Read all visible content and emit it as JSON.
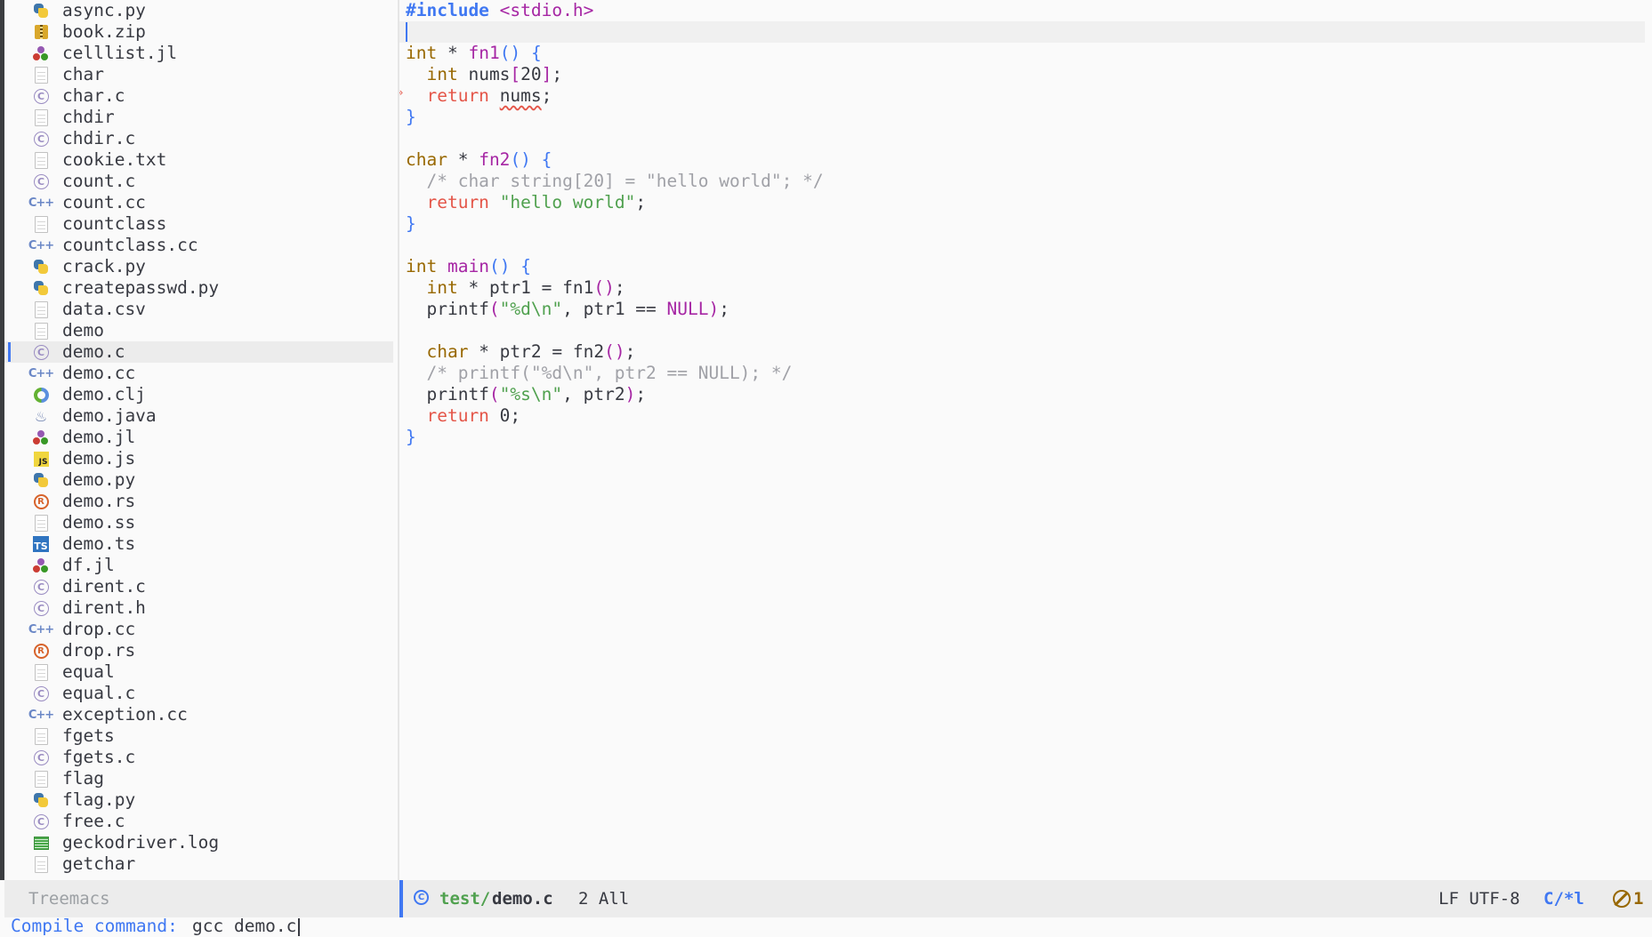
{
  "sidebar": {
    "label": "Treemacs",
    "files": [
      {
        "name": "async.py",
        "icon": "python-icon"
      },
      {
        "name": "book.zip",
        "icon": "zip-icon"
      },
      {
        "name": "celllist.jl",
        "icon": "julia-icon"
      },
      {
        "name": "char",
        "icon": "file-icon"
      },
      {
        "name": "char.c",
        "icon": "c-icon"
      },
      {
        "name": "chdir",
        "icon": "file-icon"
      },
      {
        "name": "chdir.c",
        "icon": "c-icon"
      },
      {
        "name": "cookie.txt",
        "icon": "file-icon"
      },
      {
        "name": "count.c",
        "icon": "c-icon"
      },
      {
        "name": "count.cc",
        "icon": "cpp-icon"
      },
      {
        "name": "countclass",
        "icon": "file-icon"
      },
      {
        "name": "countclass.cc",
        "icon": "cpp-icon"
      },
      {
        "name": "crack.py",
        "icon": "python-icon"
      },
      {
        "name": "createpasswd.py",
        "icon": "python-icon"
      },
      {
        "name": "data.csv",
        "icon": "file-icon"
      },
      {
        "name": "demo",
        "icon": "file-icon"
      },
      {
        "name": "demo.c",
        "icon": "c-icon",
        "selected": true
      },
      {
        "name": "demo.cc",
        "icon": "cpp-icon"
      },
      {
        "name": "demo.clj",
        "icon": "clojure-icon"
      },
      {
        "name": "demo.java",
        "icon": "java-icon"
      },
      {
        "name": "demo.jl",
        "icon": "julia-icon"
      },
      {
        "name": "demo.js",
        "icon": "javascript-icon"
      },
      {
        "name": "demo.py",
        "icon": "python-icon"
      },
      {
        "name": "demo.rs",
        "icon": "rust-icon"
      },
      {
        "name": "demo.ss",
        "icon": "file-icon"
      },
      {
        "name": "demo.ts",
        "icon": "typescript-icon"
      },
      {
        "name": "df.jl",
        "icon": "julia-icon"
      },
      {
        "name": "dirent.c",
        "icon": "c-icon"
      },
      {
        "name": "dirent.h",
        "icon": "c-icon"
      },
      {
        "name": "drop.cc",
        "icon": "cpp-icon"
      },
      {
        "name": "drop.rs",
        "icon": "rust-icon"
      },
      {
        "name": "equal",
        "icon": "file-icon"
      },
      {
        "name": "equal.c",
        "icon": "c-icon"
      },
      {
        "name": "exception.cc",
        "icon": "cpp-icon"
      },
      {
        "name": "fgets",
        "icon": "file-icon"
      },
      {
        "name": "fgets.c",
        "icon": "c-icon"
      },
      {
        "name": "flag",
        "icon": "file-icon"
      },
      {
        "name": "flag.py",
        "icon": "python-icon"
      },
      {
        "name": "free.c",
        "icon": "c-icon"
      },
      {
        "name": "geckodriver.log",
        "icon": "log-icon"
      },
      {
        "name": "getchar",
        "icon": "file-icon"
      }
    ]
  },
  "code": {
    "lines": [
      [
        {
          "t": "#include",
          "c": "kw-pre"
        },
        {
          "t": " "
        },
        {
          "t": "<stdio.h>",
          "c": "inc"
        }
      ],
      [],
      [
        {
          "t": "int",
          "c": "type"
        },
        {
          "t": " * "
        },
        {
          "t": "fn1",
          "c": "fn"
        },
        {
          "t": "()",
          "c": "paren"
        },
        {
          "t": " "
        },
        {
          "t": "{",
          "c": "paren"
        }
      ],
      [
        {
          "t": "  "
        },
        {
          "t": "int",
          "c": "type"
        },
        {
          "t": " nums"
        },
        {
          "t": "[",
          "c": "fn"
        },
        {
          "t": "20"
        },
        {
          "t": "]",
          "c": "fn"
        },
        {
          "t": ";"
        }
      ],
      [
        {
          "t": "  "
        },
        {
          "t": "return",
          "c": "ret"
        },
        {
          "t": " "
        },
        {
          "t": "nums",
          "c": "warn"
        },
        {
          "t": ";"
        }
      ],
      [
        {
          "t": "}",
          "c": "paren"
        }
      ],
      [],
      [
        {
          "t": "char",
          "c": "type"
        },
        {
          "t": " * "
        },
        {
          "t": "fn2",
          "c": "fn"
        },
        {
          "t": "()",
          "c": "paren"
        },
        {
          "t": " "
        },
        {
          "t": "{",
          "c": "paren"
        }
      ],
      [
        {
          "t": "  "
        },
        {
          "t": "/* char string[20] = \"hello world\"; */",
          "c": "cmt"
        }
      ],
      [
        {
          "t": "  "
        },
        {
          "t": "return",
          "c": "ret"
        },
        {
          "t": " "
        },
        {
          "t": "\"hello world\"",
          "c": "str"
        },
        {
          "t": ";"
        }
      ],
      [
        {
          "t": "}",
          "c": "paren"
        }
      ],
      [],
      [
        {
          "t": "int",
          "c": "type"
        },
        {
          "t": " "
        },
        {
          "t": "main",
          "c": "fn"
        },
        {
          "t": "()",
          "c": "paren"
        },
        {
          "t": " "
        },
        {
          "t": "{",
          "c": "paren"
        }
      ],
      [
        {
          "t": "  "
        },
        {
          "t": "int",
          "c": "type"
        },
        {
          "t": " * ptr1 = fn1"
        },
        {
          "t": "()",
          "c": "fn"
        },
        {
          "t": ";"
        }
      ],
      [
        {
          "t": "  printf"
        },
        {
          "t": "(",
          "c": "fn"
        },
        {
          "t": "\"%d\\n\"",
          "c": "str"
        },
        {
          "t": ", ptr1 == "
        },
        {
          "t": "NULL",
          "c": "const"
        },
        {
          "t": ")",
          "c": "fn"
        },
        {
          "t": ";"
        }
      ],
      [],
      [
        {
          "t": "  "
        },
        {
          "t": "char",
          "c": "type"
        },
        {
          "t": " * ptr2 = fn2"
        },
        {
          "t": "()",
          "c": "fn"
        },
        {
          "t": ";"
        }
      ],
      [
        {
          "t": "  "
        },
        {
          "t": "/* printf(\"%d\\n\", ptr2 == NULL); */",
          "c": "cmt"
        }
      ],
      [
        {
          "t": "  printf"
        },
        {
          "t": "(",
          "c": "fn"
        },
        {
          "t": "\"%s\\n\"",
          "c": "str"
        },
        {
          "t": ", ptr2"
        },
        {
          "t": ")",
          "c": "fn"
        },
        {
          "t": ";"
        }
      ],
      [
        {
          "t": "  "
        },
        {
          "t": "return",
          "c": "ret"
        },
        {
          "t": " 0;"
        }
      ],
      [
        {
          "t": "}",
          "c": "paren"
        }
      ]
    ]
  },
  "modeline": {
    "dir": "test/",
    "file": "demo.c",
    "position": "2 All",
    "encoding": "LF UTF-8",
    "mode": "C/*l",
    "errors": "1"
  },
  "minibuffer": {
    "prompt": "Compile command: ",
    "input": "gcc demo.c"
  }
}
